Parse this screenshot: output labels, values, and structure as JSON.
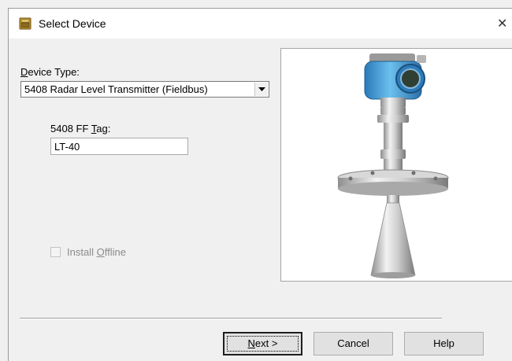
{
  "window": {
    "title": "Select Device",
    "title_icon": "device-folder-icon",
    "close_glyph": "✕"
  },
  "device_type": {
    "label_mnemonic": "D",
    "label_rest": "evice Type:",
    "selected": "5408 Radar Level Transmitter (Fieldbus)"
  },
  "tag": {
    "label_pre": "5408 FF ",
    "label_mnemonic": "T",
    "label_post": "ag:",
    "value": "LT-40"
  },
  "install_offline": {
    "label_pre": "Install ",
    "label_mnemonic": "O",
    "label_post": "ffline",
    "checked": false,
    "enabled": false
  },
  "preview": {
    "subject": "radar-level-transmitter-photo"
  },
  "buttons": {
    "next_mnemonic": "N",
    "next_rest": "ext >",
    "cancel": "Cancel",
    "help": "Help"
  },
  "colors": {
    "housing_blue": "#4aa0d8",
    "steel": "#c9c9c9",
    "background": "#f0f0f0"
  }
}
